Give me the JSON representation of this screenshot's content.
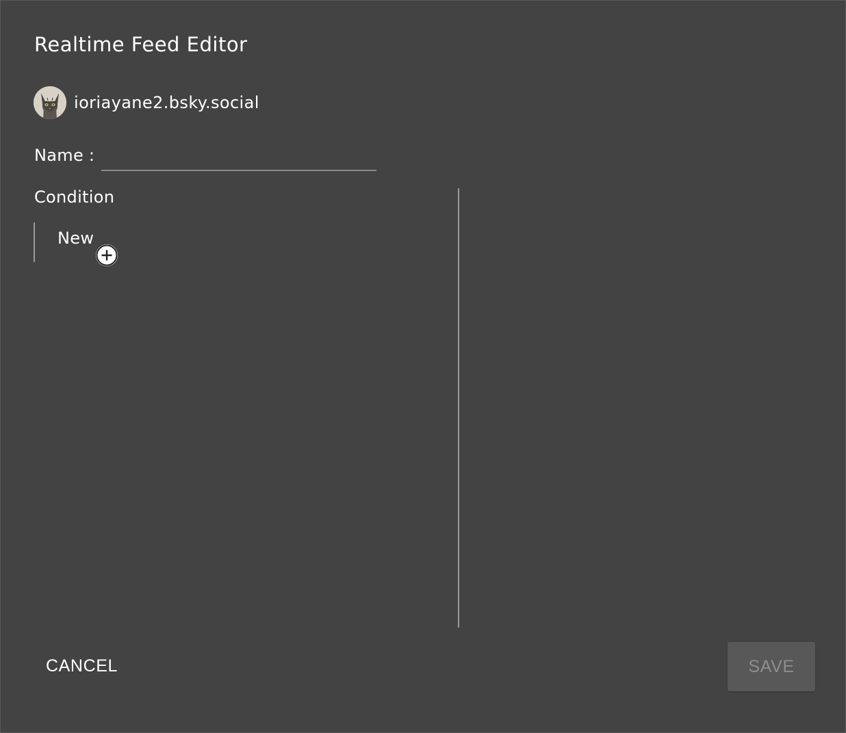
{
  "dialog": {
    "title": "Realtime Feed Editor"
  },
  "account": {
    "avatar_icon": "cat-avatar",
    "handle": "ioriayane2.bsky.social"
  },
  "name_field": {
    "label": "Name :",
    "value": "",
    "placeholder": ""
  },
  "condition": {
    "heading": "Condition",
    "items": [
      {
        "label": "New",
        "action_icon": "plus-circle-icon"
      }
    ]
  },
  "actions": {
    "cancel_label": "CANCEL",
    "save_label": "SAVE",
    "save_enabled": false
  },
  "colors": {
    "background": "#434343",
    "text": "#ffffff",
    "divider": "#9a9a9a",
    "save_disabled_bg": "#585858",
    "save_disabled_text": "#8d8d8d"
  }
}
